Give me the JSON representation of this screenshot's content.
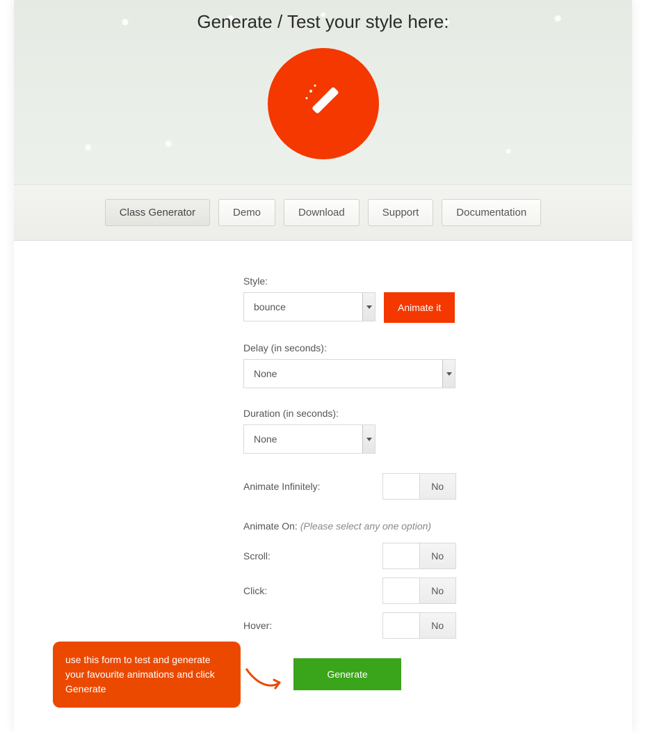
{
  "hero": {
    "title": "Generate / Test your style here:"
  },
  "nav": {
    "items": [
      {
        "label": "Class Generator",
        "active": true
      },
      {
        "label": "Demo"
      },
      {
        "label": "Download"
      },
      {
        "label": "Support"
      },
      {
        "label": "Documentation"
      }
    ]
  },
  "form": {
    "style_label": "Style:",
    "style_value": "bounce",
    "animate_btn": "Animate it",
    "delay_label": "Delay (in seconds):",
    "delay_value": "None",
    "duration_label": "Duration (in seconds):",
    "duration_value": "None",
    "infinite_label": "Animate Infinitely:",
    "infinite_value": "No",
    "animate_on_label": "Animate On:",
    "animate_on_hint": "(Please select any one option)",
    "scroll_label": "Scroll:",
    "scroll_value": "No",
    "click_label": "Click:",
    "click_value": "No",
    "hover_label": "Hover:",
    "hover_value": "No",
    "generate_btn": "Generate"
  },
  "tooltip": "use this form to test and generate your favourite animations and click Generate"
}
